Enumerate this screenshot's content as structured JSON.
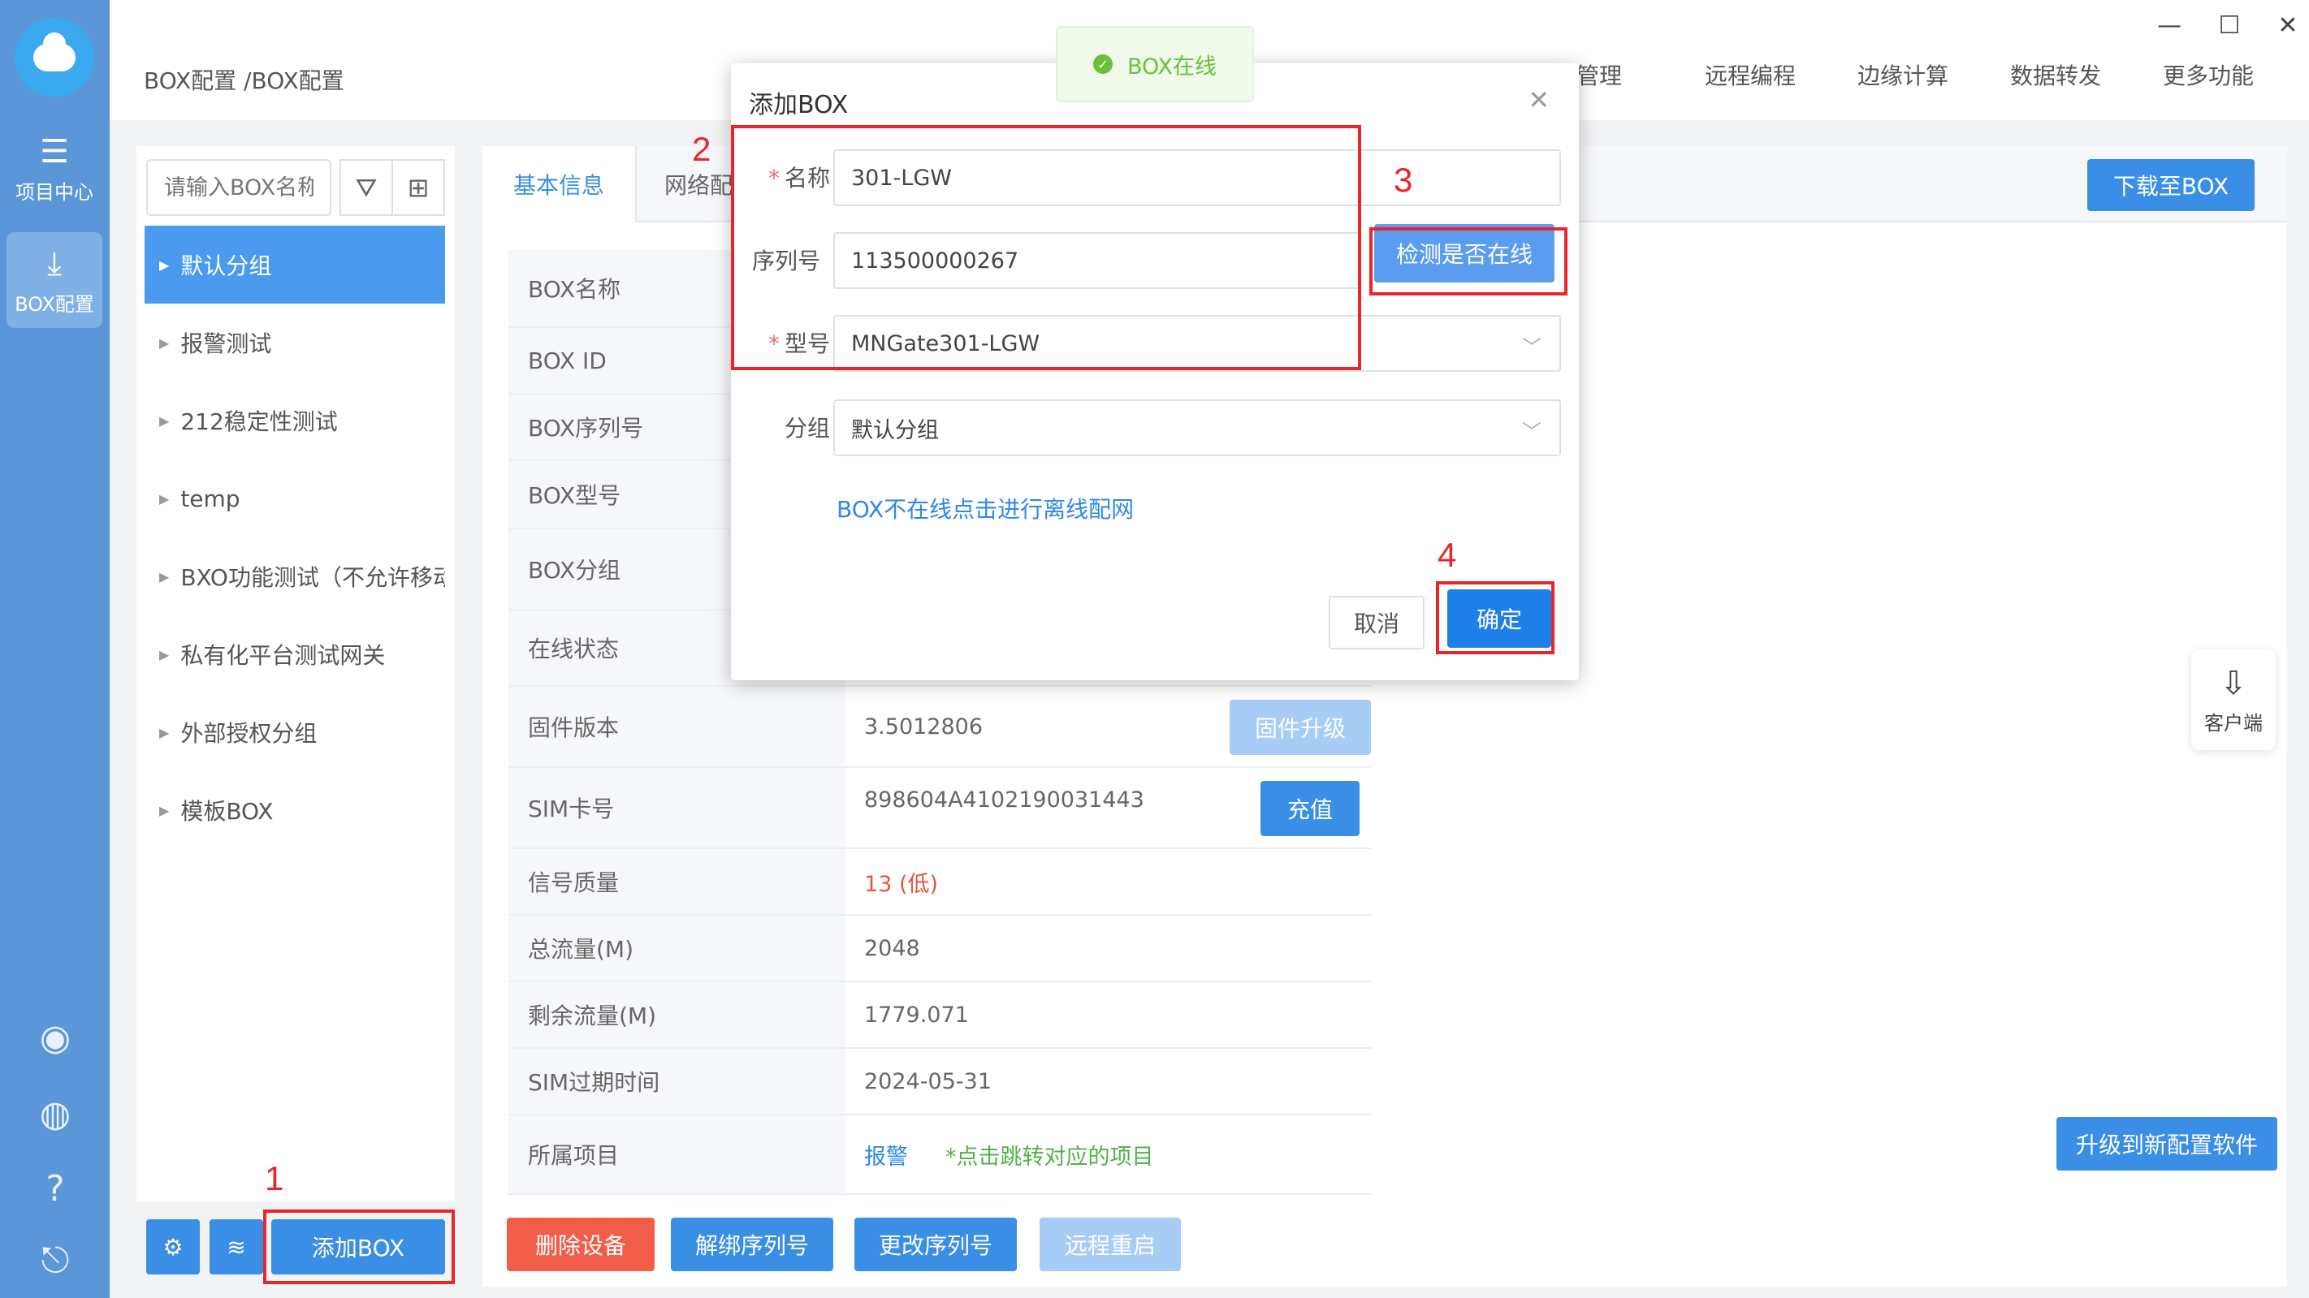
{
  "sidebar": {
    "items": [
      {
        "label": "项目中心",
        "icon": "list-icon"
      },
      {
        "label": "BOX配置",
        "icon": "download-icon"
      }
    ],
    "bottom_icons": [
      "user-icon",
      "globe-icon",
      "help-icon",
      "exit-icon"
    ]
  },
  "header": {
    "breadcrumb": "BOX配置 /BOX配置",
    "menu": [
      "警管理",
      "远程编程",
      "边缘计算",
      "数据转发",
      "更多功能"
    ]
  },
  "window": {
    "minimize": "—",
    "maximize": "☐",
    "close": "✕"
  },
  "groups": {
    "search_placeholder": "请输入BOX名称",
    "items": [
      {
        "label": "默认分组",
        "active": true
      },
      {
        "label": "报警测试"
      },
      {
        "label": "212稳定性测试"
      },
      {
        "label": "temp"
      },
      {
        "label": "BXO功能测试（不允许移动）"
      },
      {
        "label": "私有化平台测试网关"
      },
      {
        "label": "外部授权分组"
      },
      {
        "label": "模板BOX"
      }
    ],
    "add_box": "添加BOX"
  },
  "tabs": [
    {
      "label": "基本信息",
      "active": true
    },
    {
      "label": "网络配"
    }
  ],
  "download_btn": "下载至BOX",
  "info": {
    "rows": [
      {
        "key": "BOX名称",
        "value": ""
      },
      {
        "key": "BOX ID",
        "value": ""
      },
      {
        "key": "BOX序列号",
        "value": ""
      },
      {
        "key": "BOX型号",
        "value": ""
      },
      {
        "key": "BOX分组",
        "value": ""
      },
      {
        "key": "在线状态",
        "value": ""
      },
      {
        "key": "固件版本",
        "value": "3.5012806",
        "action": "固件升级"
      },
      {
        "key": "SIM卡号",
        "value": "898604A4102190031443",
        "action": "充值"
      },
      {
        "key": "信号质量",
        "value": "13 (低)"
      },
      {
        "key": "总流量(M)",
        "value": "2048"
      },
      {
        "key": "剩余流量(M)",
        "value": "1779.071"
      },
      {
        "key": "SIM过期时间",
        "value": "2024-05-31"
      },
      {
        "key": "所属项目",
        "value": "报警",
        "note": "*点击跳转对应的项目"
      }
    ]
  },
  "bottom_actions": [
    "删除设备",
    "解绑序列号",
    "更改序列号",
    "远程重启"
  ],
  "upgrade_soft": "升级到新配置软件",
  "client": "客户端",
  "toast": "BOX在线",
  "dialog": {
    "title": "添加BOX",
    "name_label": "名称",
    "name_value": "301-LGW",
    "serial_label": "序列号",
    "serial_value": "113500000267",
    "check_btn": "检测是否在线",
    "model_label": "型号",
    "model_value": "MNGate301-LGW",
    "group_label": "分组",
    "group_value": "默认分组",
    "offline_link": "BOX不在线点击进行离线配网",
    "cancel": "取消",
    "ok": "确定"
  },
  "annotations": [
    "1",
    "2",
    "3",
    "4"
  ],
  "colors": {
    "accent": "#3a8ee6",
    "danger": "#f25d4a",
    "annotation": "#e8262a",
    "success": "#67c23a"
  }
}
